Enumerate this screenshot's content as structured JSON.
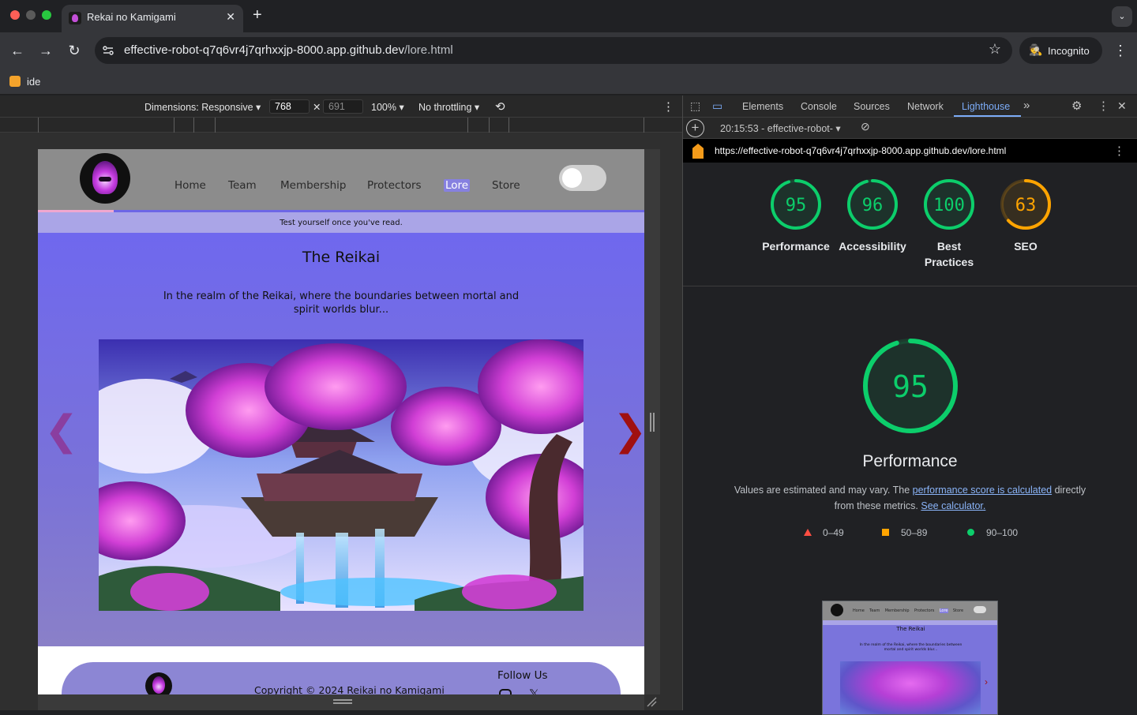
{
  "browser": {
    "tab_title": "Rekai no Kamigami",
    "url_host": "effective-robot-q7q6vr4j7qrhxxjp-8000.app.github.dev",
    "url_path": "/lore.html",
    "incognito_label": "Incognito",
    "bookmark_label": "ide"
  },
  "device_toolbar": {
    "dimensions_label": "Dimensions: Responsive",
    "width": "768",
    "height": "691",
    "zoom": "100%",
    "throttling": "No throttling"
  },
  "site": {
    "nav": [
      "Home",
      "Team",
      "Membership",
      "Protectors",
      "Lore",
      "Store"
    ],
    "active_nav": "Lore",
    "reading_progress": 0.125,
    "quiz_banner": "Test yourself once you've read.",
    "lore_title": "The Reikai",
    "lore_text": "In the realm of the Reikai, where the boundaries between mortal and spirit worlds blur...",
    "prev_arrow": "❮",
    "next_arrow": "❯",
    "copyright": "Copyright © 2024 Reikai no Kamigami",
    "follow_us": "Follow Us"
  },
  "devtools": {
    "tabs": [
      "Elements",
      "Console",
      "Sources",
      "Network",
      "Lighthouse"
    ],
    "active_tab": "Lighthouse",
    "run_label": "20:15:53 - effective-robot-",
    "audited_url": "https://effective-robot-q7q6vr4j7qrhxxjp-8000.app.github.dev/lore.html",
    "scores": [
      {
        "label": "Performance",
        "value": 95,
        "color": "#0cce6b"
      },
      {
        "label": "Accessibility",
        "value": 96,
        "color": "#0cce6b"
      },
      {
        "label": "Best Practices",
        "value": 100,
        "color": "#0cce6b"
      },
      {
        "label": "SEO",
        "value": 63,
        "color": "#ffa400"
      }
    ],
    "focus": {
      "value": 95,
      "title": "Performance",
      "note_prefix": "Values are estimated and may vary. The ",
      "note_link1": "performance score is calculated",
      "note_mid": " directly from these metrics. ",
      "note_link2": "See calculator."
    },
    "legend": [
      {
        "range": "0–49",
        "color": "#ff4e42",
        "shape": "triangle"
      },
      {
        "range": "50–89",
        "color": "#ffa400",
        "shape": "square"
      },
      {
        "range": "90–100",
        "color": "#0cce6b",
        "shape": "circle"
      }
    ],
    "thumb": {
      "nav": [
        "Home",
        "Team",
        "Membership",
        "Protectors",
        "Lore",
        "Store"
      ],
      "title": "The Reikai",
      "text": "In the realm of the Reikai, where the boundaries between mortal and spirit worlds blur..."
    }
  }
}
